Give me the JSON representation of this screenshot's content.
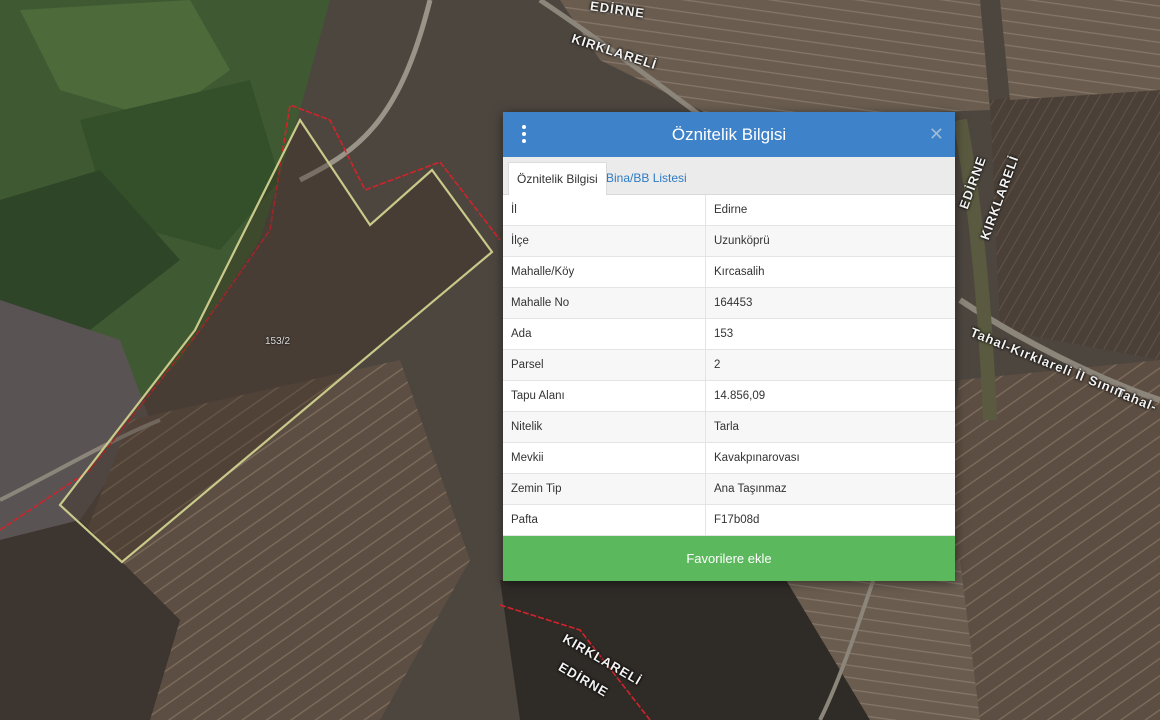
{
  "map": {
    "labels": {
      "edirne_top": "EDİRNE",
      "kirklareli_top": "KIRKLARELİ",
      "edirne_right": "EDİRNE",
      "kirklareli_right": "KIRKLARELİ",
      "road": "Tahal-Kırklareli İl Sınırı",
      "road_cut": "Tahal-",
      "kirklareli_bottom": "KIRKLARELİ",
      "edirne_bottom": "EDİRNE",
      "parcel": "153/2"
    }
  },
  "panel": {
    "title": "Öznitelik Bilgisi",
    "menu_icon": "vertical-dots-icon",
    "close_icon": "close-icon",
    "tabs": [
      {
        "label": "Öznitelik Bilgisi",
        "active": true
      },
      {
        "label": "Bina/BB Listesi",
        "active": false
      }
    ],
    "rows": [
      {
        "key": "İl",
        "value": "Edirne"
      },
      {
        "key": "İlçe",
        "value": "Uzunköprü"
      },
      {
        "key": "Mahalle/Köy",
        "value": "Kırcasalih"
      },
      {
        "key": "Mahalle No",
        "value": "164453"
      },
      {
        "key": "Ada",
        "value": "153"
      },
      {
        "key": "Parsel",
        "value": "2"
      },
      {
        "key": "Tapu Alanı",
        "value": "14.856,09"
      },
      {
        "key": "Nitelik",
        "value": "Tarla"
      },
      {
        "key": "Mevkii",
        "value": "Kavakpınarovası"
      },
      {
        "key": "Zemin Tip",
        "value": "Ana Taşınmaz"
      },
      {
        "key": "Pafta",
        "value": "F17b08d"
      }
    ],
    "favorite_button": "Favorilere ekle"
  },
  "colors": {
    "header": "#3e82c9",
    "favorite": "#5cb85c",
    "tab_link": "#2e7bc4",
    "parcel_outline": "#c9c98a",
    "border_line": "#d2232a"
  }
}
